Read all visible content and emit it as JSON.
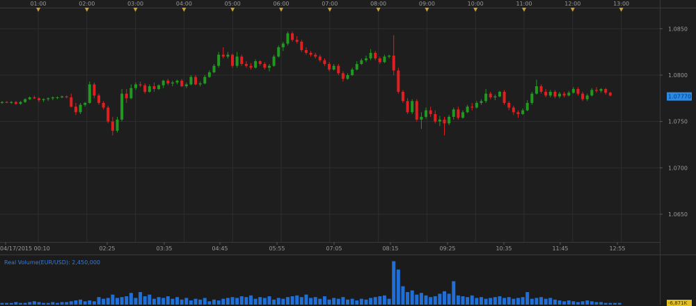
{
  "chart_data": [
    {
      "type": "candlestick",
      "top_axis_labels": [
        "01:00",
        "02:00",
        "03:00",
        "04:00",
        "05:00",
        "06:00",
        "07:00",
        "08:00",
        "09:00",
        "10:00",
        "11:00",
        "12:00",
        "13:00"
      ],
      "bottom_axis_labels": [
        "04/17/2015 00:10",
        "02:25",
        "03:35",
        "04:45",
        "05:55",
        "07:05",
        "08:15",
        "09:25",
        "10:35",
        "11:45",
        "12:55"
      ],
      "price_ticks": [
        "1.0850",
        "1.0800",
        "1.0750",
        "1.0700",
        "1.0650"
      ],
      "ylim": [
        1.062,
        1.0872
      ],
      "current_price": "1.07770",
      "colors": {
        "up": "#1f9a1f",
        "down": "#e02020",
        "background": "#1e1e1e",
        "grid": "#2e2e2e",
        "marker": "#c8a030",
        "current": "#2a8ae6"
      },
      "candles": [
        [
          1.077,
          1.0772,
          1.0769,
          1.0771
        ],
        [
          1.0771,
          1.0772,
          1.077,
          1.077
        ],
        [
          1.077,
          1.0772,
          1.0769,
          1.0771
        ],
        [
          1.0771,
          1.0772,
          1.0768,
          1.0769
        ],
        [
          1.0769,
          1.0772,
          1.0768,
          1.0771
        ],
        [
          1.0771,
          1.0775,
          1.077,
          1.0774
        ],
        [
          1.0774,
          1.0777,
          1.0773,
          1.0776
        ],
        [
          1.0776,
          1.0778,
          1.0774,
          1.0775
        ],
        [
          1.0775,
          1.0776,
          1.0771,
          1.0773
        ],
        [
          1.0773,
          1.0775,
          1.0771,
          1.0774
        ],
        [
          1.0774,
          1.0776,
          1.0772,
          1.0775
        ],
        [
          1.0775,
          1.0777,
          1.0773,
          1.0776
        ],
        [
          1.0776,
          1.0777,
          1.0774,
          1.0776
        ],
        [
          1.0776,
          1.0778,
          1.0775,
          1.0777
        ],
        [
          1.0777,
          1.0778,
          1.0775,
          1.0776
        ],
        [
          1.0776,
          1.078,
          1.0765,
          1.0766
        ],
        [
          1.0766,
          1.077,
          1.0757,
          1.076
        ],
        [
          1.076,
          1.077,
          1.0758,
          1.0768
        ],
        [
          1.0768,
          1.0771,
          1.0766,
          1.077
        ],
        [
          1.077,
          1.0793,
          1.0769,
          1.079
        ],
        [
          1.079,
          1.0792,
          1.0775,
          1.0778
        ],
        [
          1.0778,
          1.078,
          1.0768,
          1.077
        ],
        [
          1.077,
          1.0772,
          1.0763,
          1.0765
        ],
        [
          1.0765,
          1.0767,
          1.0748,
          1.075
        ],
        [
          1.075,
          1.0755,
          1.0735,
          1.074
        ],
        [
          1.074,
          1.0755,
          1.0738,
          1.0752
        ],
        [
          1.0752,
          1.0785,
          1.075,
          1.078
        ],
        [
          1.078,
          1.0785,
          1.077,
          1.0775
        ],
        [
          1.0775,
          1.079,
          1.0774,
          1.0786
        ],
        [
          1.0786,
          1.0792,
          1.0784,
          1.079
        ],
        [
          1.079,
          1.0793,
          1.0787,
          1.0789
        ],
        [
          1.0789,
          1.0791,
          1.078,
          1.0782
        ],
        [
          1.0782,
          1.079,
          1.0781,
          1.0788
        ],
        [
          1.0788,
          1.0792,
          1.0782,
          1.0785
        ],
        [
          1.0785,
          1.079,
          1.0784,
          1.0789
        ],
        [
          1.0789,
          1.0795,
          1.0786,
          1.0794
        ],
        [
          1.0794,
          1.0796,
          1.0789,
          1.0791
        ],
        [
          1.0791,
          1.0794,
          1.0788,
          1.0792
        ],
        [
          1.0792,
          1.0795,
          1.079,
          1.0794
        ],
        [
          1.0794,
          1.0796,
          1.0787,
          1.0788
        ],
        [
          1.0788,
          1.0792,
          1.0786,
          1.079
        ],
        [
          1.079,
          1.08,
          1.0789,
          1.0798
        ],
        [
          1.0798,
          1.08,
          1.0789,
          1.079
        ],
        [
          1.079,
          1.0793,
          1.0788,
          1.0791
        ],
        [
          1.0791,
          1.08,
          1.079,
          1.0798
        ],
        [
          1.0798,
          1.0805,
          1.0797,
          1.0803
        ],
        [
          1.0803,
          1.0812,
          1.0802,
          1.081
        ],
        [
          1.081,
          1.0825,
          1.0808,
          1.0822
        ],
        [
          1.0822,
          1.083,
          1.0818,
          1.082
        ],
        [
          1.082,
          1.0825,
          1.0818,
          1.0822
        ],
        [
          1.0822,
          1.0823,
          1.0808,
          1.081
        ],
        [
          1.081,
          1.0825,
          1.0808,
          1.082
        ],
        [
          1.082,
          1.0822,
          1.081,
          1.0812
        ],
        [
          1.0812,
          1.0815,
          1.0808,
          1.081
        ],
        [
          1.081,
          1.0813,
          1.0806,
          1.0808
        ],
        [
          1.0808,
          1.0817,
          1.0807,
          1.0815
        ],
        [
          1.0815,
          1.0816,
          1.081,
          1.0812
        ],
        [
          1.0812,
          1.0814,
          1.0806,
          1.0808
        ],
        [
          1.0808,
          1.0812,
          1.0804,
          1.081
        ],
        [
          1.081,
          1.0822,
          1.0809,
          1.082
        ],
        [
          1.082,
          1.0832,
          1.0819,
          1.083
        ],
        [
          1.083,
          1.0836,
          1.0826,
          1.0834
        ],
        [
          1.0834,
          1.0847,
          1.0832,
          1.0845
        ],
        [
          1.0845,
          1.0847,
          1.0836,
          1.0838
        ],
        [
          1.0838,
          1.0842,
          1.0834,
          1.0836
        ],
        [
          1.0836,
          1.0838,
          1.0825,
          1.0827
        ],
        [
          1.0827,
          1.083,
          1.0822,
          1.0824
        ],
        [
          1.0824,
          1.0826,
          1.082,
          1.0822
        ],
        [
          1.0822,
          1.0824,
          1.0818,
          1.082
        ],
        [
          1.082,
          1.0822,
          1.0814,
          1.0816
        ],
        [
          1.0816,
          1.0818,
          1.081,
          1.0812
        ],
        [
          1.0812,
          1.0814,
          1.0804,
          1.0806
        ],
        [
          1.0806,
          1.0812,
          1.0805,
          1.081
        ],
        [
          1.081,
          1.0812,
          1.08,
          1.0802
        ],
        [
          1.0802,
          1.0804,
          1.0793,
          1.0796
        ],
        [
          1.0796,
          1.0802,
          1.0795,
          1.08
        ],
        [
          1.08,
          1.0808,
          1.0799,
          1.0806
        ],
        [
          1.0806,
          1.0815,
          1.0805,
          1.0812
        ],
        [
          1.0812,
          1.0818,
          1.0811,
          1.0816
        ],
        [
          1.0816,
          1.0821,
          1.0814,
          1.0818
        ],
        [
          1.0818,
          1.0828,
          1.0816,
          1.0824
        ],
        [
          1.0824,
          1.0826,
          1.0816,
          1.0818
        ],
        [
          1.0818,
          1.082,
          1.0812,
          1.0814
        ],
        [
          1.0814,
          1.0822,
          1.0813,
          1.082
        ],
        [
          1.082,
          1.0822,
          1.0818,
          1.0821
        ],
        [
          1.0821,
          1.0843,
          1.08,
          1.0805
        ],
        [
          1.0805,
          1.0808,
          1.078,
          1.0782
        ],
        [
          1.0782,
          1.0784,
          1.077,
          1.0772
        ],
        [
          1.0772,
          1.0775,
          1.0758,
          1.076
        ],
        [
          1.076,
          1.0774,
          1.0758,
          1.0772
        ],
        [
          1.0772,
          1.0774,
          1.075,
          1.0752
        ],
        [
          1.0752,
          1.076,
          1.0742,
          1.0755
        ],
        [
          1.0755,
          1.0765,
          1.0753,
          1.0762
        ],
        [
          1.0762,
          1.0766,
          1.0755,
          1.0758
        ],
        [
          1.0758,
          1.0762,
          1.0748,
          1.075
        ],
        [
          1.075,
          1.0756,
          1.0745,
          1.0752
        ],
        [
          1.0752,
          1.0755,
          1.0735,
          1.0748
        ],
        [
          1.0748,
          1.0757,
          1.0746,
          1.0755
        ],
        [
          1.0755,
          1.0765,
          1.0752,
          1.0763
        ],
        [
          1.0763,
          1.0766,
          1.0752,
          1.0754
        ],
        [
          1.0754,
          1.0762,
          1.0753,
          1.076
        ],
        [
          1.076,
          1.0768,
          1.0759,
          1.0766
        ],
        [
          1.0766,
          1.077,
          1.0762,
          1.0765
        ],
        [
          1.0765,
          1.0772,
          1.0764,
          1.077
        ],
        [
          1.077,
          1.0774,
          1.0768,
          1.0772
        ],
        [
          1.0772,
          1.0785,
          1.077,
          1.078
        ],
        [
          1.078,
          1.0782,
          1.0774,
          1.0776
        ],
        [
          1.0776,
          1.0779,
          1.0773,
          1.0777
        ],
        [
          1.0777,
          1.0783,
          1.0776,
          1.0782
        ],
        [
          1.0782,
          1.0784,
          1.0768,
          1.077
        ],
        [
          1.077,
          1.0772,
          1.0762,
          1.0765
        ],
        [
          1.0765,
          1.0767,
          1.0757,
          1.076
        ],
        [
          1.076,
          1.0762,
          1.0754,
          1.0758
        ],
        [
          1.0758,
          1.0764,
          1.0757,
          1.0762
        ],
        [
          1.0762,
          1.0773,
          1.0761,
          1.077
        ],
        [
          1.077,
          1.0782,
          1.0768,
          1.078
        ],
        [
          1.078,
          1.0795,
          1.0779,
          1.0788
        ],
        [
          1.0788,
          1.079,
          1.078,
          1.0782
        ],
        [
          1.0782,
          1.0785,
          1.0776,
          1.0778
        ],
        [
          1.0778,
          1.0784,
          1.0776,
          1.0782
        ],
        [
          1.0782,
          1.0784,
          1.0775,
          1.0777
        ],
        [
          1.0777,
          1.0782,
          1.0775,
          1.078
        ],
        [
          1.078,
          1.0782,
          1.0776,
          1.0778
        ],
        [
          1.0778,
          1.0783,
          1.0777,
          1.0781
        ],
        [
          1.0781,
          1.0787,
          1.078,
          1.0785
        ],
        [
          1.0785,
          1.0787,
          1.0778,
          1.078
        ],
        [
          1.078,
          1.0782,
          1.0772,
          1.0774
        ],
        [
          1.0774,
          1.078,
          1.0772,
          1.0778
        ],
        [
          1.0778,
          1.0786,
          1.0777,
          1.0784
        ],
        [
          1.0784,
          1.0787,
          1.0781,
          1.0783
        ],
        [
          1.0783,
          1.0786,
          1.0781,
          1.0785
        ],
        [
          1.0785,
          1.0786,
          1.0779,
          1.0781
        ],
        [
          1.0781,
          1.0782,
          1.0777,
          1.0778
        ]
      ]
    },
    {
      "type": "bar",
      "title": "Real Volume(EUR/USD): 2,450,000",
      "current_label": "-6,871K",
      "color": "#1f6fd6",
      "values": [
        2,
        2,
        2,
        3,
        2,
        2,
        3,
        4,
        3,
        2,
        2,
        3,
        2,
        3,
        3,
        4,
        5,
        6,
        4,
        5,
        4,
        9,
        7,
        8,
        12,
        8,
        9,
        10,
        14,
        8,
        15,
        10,
        12,
        7,
        9,
        8,
        10,
        7,
        9,
        6,
        8,
        5,
        7,
        6,
        8,
        4,
        6,
        5,
        7,
        8,
        9,
        8,
        10,
        9,
        11,
        7,
        9,
        8,
        10,
        6,
        8,
        7,
        9,
        10,
        11,
        9,
        12,
        8,
        9,
        7,
        10,
        6,
        8,
        7,
        9,
        6,
        7,
        5,
        7,
        6,
        8,
        9,
        10,
        11,
        7,
        52,
        42,
        22,
        15,
        17,
        12,
        14,
        11,
        9,
        10,
        13,
        16,
        13,
        28,
        11,
        10,
        9,
        11,
        8,
        9,
        7,
        8,
        9,
        10,
        8,
        9,
        7,
        8,
        9,
        15,
        7,
        8,
        9,
        7,
        8,
        6,
        5,
        4,
        5,
        4,
        3,
        4,
        5,
        4,
        3,
        3,
        2,
        2,
        2,
        2
      ]
    }
  ]
}
